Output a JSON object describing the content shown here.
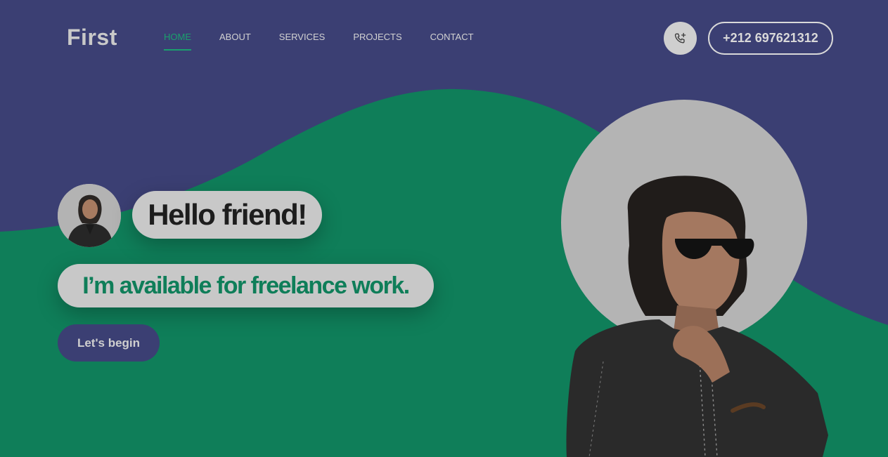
{
  "brand": {
    "logo": "First"
  },
  "nav": {
    "items": [
      {
        "label": "HOME",
        "active": true
      },
      {
        "label": "ABOUT",
        "active": false
      },
      {
        "label": "SERVICES",
        "active": false
      },
      {
        "label": "PROJECTS",
        "active": false
      },
      {
        "label": "CONTACT",
        "active": false
      }
    ]
  },
  "contact": {
    "icon": "phone-plus-icon",
    "phone": "+212 697621312"
  },
  "hero": {
    "greeting": "Hello friend!",
    "tagline": "I’m available for freelance work.",
    "cta": "Let's begin"
  },
  "colors": {
    "navy": "#3b3f73",
    "green": "#0f7e59",
    "accent_green": "#1aa06d",
    "bubble": "#c8c8c8"
  }
}
